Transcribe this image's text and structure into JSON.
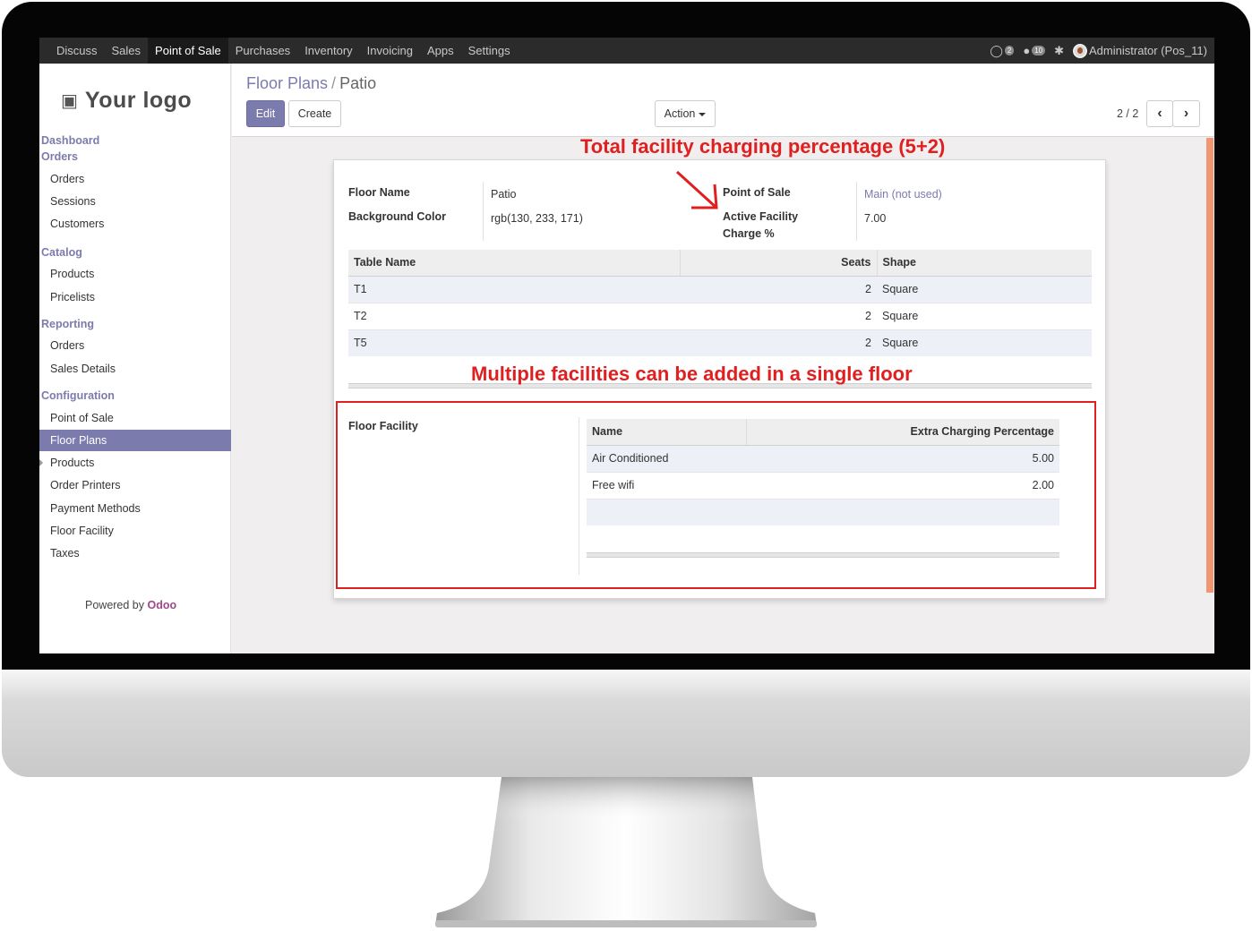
{
  "topbar": {
    "menu": [
      "Discuss",
      "Sales",
      "Point of Sale",
      "Purchases",
      "Inventory",
      "Invoicing",
      "Apps",
      "Settings"
    ],
    "active_menu": "Point of Sale",
    "conversations_badge": "2",
    "messages_badge": "10",
    "user_label": "Administrator (Pos_11)"
  },
  "sidebar": {
    "logo_text": "Your logo",
    "dashboard": "Dashboard",
    "orders_section": "Orders",
    "orders_items": [
      "Orders",
      "Sessions",
      "Customers"
    ],
    "catalog_section": "Catalog",
    "catalog_items": [
      "Products",
      "Pricelists"
    ],
    "reporting_section": "Reporting",
    "reporting_items": [
      "Orders",
      "Sales Details"
    ],
    "configuration_section": "Configuration",
    "configuration_items": [
      "Point of Sale",
      "Floor Plans",
      "Products",
      "Order Printers",
      "Payment Methods",
      "Floor Facility",
      "Taxes"
    ],
    "active_item": "Floor Plans",
    "powered_by": "Powered by",
    "powered_brand": "Odoo"
  },
  "control": {
    "breadcrumb_parent": "Floor Plans",
    "breadcrumb_sep": "/",
    "breadcrumb_current": "Patio",
    "edit_label": "Edit",
    "create_label": "Create",
    "action_label": "Action",
    "pager": "2 / 2"
  },
  "form": {
    "floor_name_label": "Floor Name",
    "floor_name_value": "Patio",
    "bg_color_label": "Background Color",
    "bg_color_value": "rgb(130, 233, 171)",
    "pos_label": "Point of Sale",
    "pos_value": "Main (not used)",
    "facility_label_1": "Active Facility",
    "facility_label_2": "Charge %",
    "facility_value": "7.00",
    "tables_header": [
      "Table Name",
      "Seats",
      "Shape"
    ],
    "tables": [
      {
        "name": "T1",
        "seats": "2",
        "shape": "Square"
      },
      {
        "name": "T2",
        "seats": "2",
        "shape": "Square"
      },
      {
        "name": "T5",
        "seats": "2",
        "shape": "Square"
      }
    ],
    "floor_facility_label": "Floor Facility",
    "facility_header": [
      "Name",
      "Extra Charging Percentage"
    ],
    "facilities": [
      {
        "name": "Air Conditioned",
        "pct": "5.00"
      },
      {
        "name": "Free wifi",
        "pct": "2.00"
      }
    ]
  },
  "annotations": {
    "total": "Total facility charging percentage (5+2)",
    "multiple": "Multiple facilities can be added in a single floor"
  },
  "colors": {
    "brand": "#7c7bad",
    "annotation": "#e02020",
    "topbar": "#2b2b2b"
  }
}
